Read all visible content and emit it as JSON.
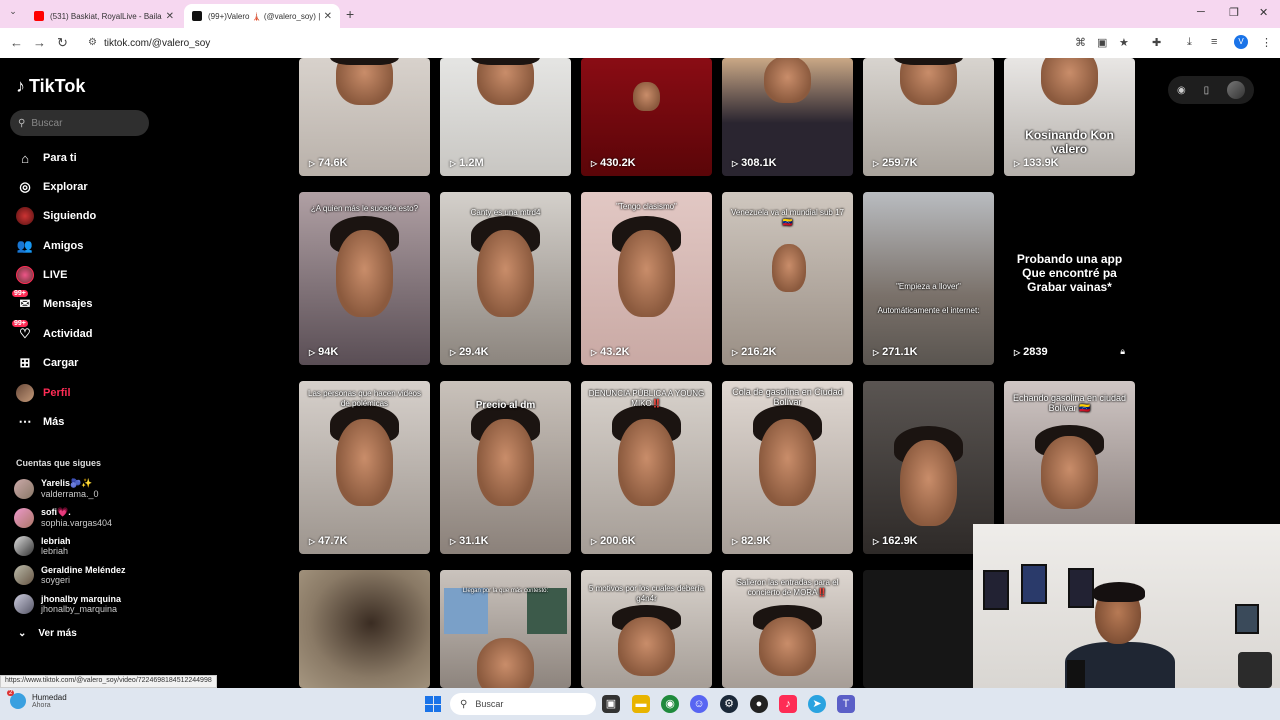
{
  "browser": {
    "tabs": [
      {
        "title": "(531) Baskiat, RoyalLive - Bailan",
        "active": false
      },
      {
        "title": "(99+)Valero 🗼 (@valero_soy) |",
        "active": true
      }
    ],
    "url": "tiktok.com/@valero_soy",
    "status_url": "https://www.tiktok.com/@valero_soy/video/7224698184512244998"
  },
  "sidebar": {
    "logo": "TikTok",
    "search_placeholder": "Buscar",
    "nav": [
      {
        "label": "Para ti",
        "icon": "home-icon"
      },
      {
        "label": "Explorar",
        "icon": "compass-icon"
      },
      {
        "label": "Siguiendo",
        "icon": "following-avatar-icon"
      },
      {
        "label": "Amigos",
        "icon": "friends-icon"
      },
      {
        "label": "LIVE",
        "icon": "live-icon"
      },
      {
        "label": "Mensajes",
        "icon": "messages-icon",
        "badge": "99+"
      },
      {
        "label": "Actividad",
        "icon": "activity-icon",
        "badge": "99+"
      },
      {
        "label": "Cargar",
        "icon": "upload-icon"
      },
      {
        "label": "Perfil",
        "icon": "profile-avatar-icon",
        "active": true
      },
      {
        "label": "Más",
        "icon": "more-icon"
      }
    ],
    "following_title": "Cuentas que sigues",
    "following": [
      {
        "name": "Yarelis🫐✨",
        "handle": "valderrama._0"
      },
      {
        "name": "sofi💗.",
        "handle": "sophia.vargas404"
      },
      {
        "name": "lebriah",
        "handle": "lebriah"
      },
      {
        "name": "Geraldine Meléndez",
        "handle": "soygeri"
      },
      {
        "name": "jhonalby marquina",
        "handle": "jhonalby_marquina"
      }
    ],
    "see_more": "Ver más"
  },
  "videos": [
    {
      "views": "74.6K",
      "caption": ""
    },
    {
      "views": "1.2M",
      "caption": ""
    },
    {
      "views": "430.2K",
      "caption": ""
    },
    {
      "views": "308.1K",
      "caption": ""
    },
    {
      "views": "259.7K",
      "caption": ""
    },
    {
      "views": "133.9K",
      "caption": "Kosinando Kon valero"
    },
    {
      "views": "94K",
      "caption": "¿A quien más le sucede esto?"
    },
    {
      "views": "29.4K",
      "caption": "Canty es una mtrd4"
    },
    {
      "views": "43.2K",
      "caption": "\"Tengo clasismo\""
    },
    {
      "views": "216.2K",
      "caption": "Venezuela va al mundial sub 17 🇻🇪"
    },
    {
      "views": "271.1K",
      "caption": "\"Empieza a llover\"",
      "caption2": "Automáticamente el internet:"
    },
    {
      "views": "2839",
      "caption": "Probando una app Que encontré pa Grabar vainas*",
      "locked": true
    },
    {
      "views": "47.7K",
      "caption": "Las personas que hacen videos de polémicas"
    },
    {
      "views": "31.1K",
      "caption": "Precio al dm"
    },
    {
      "views": "200.6K",
      "caption": "DENUNCIA PÚBLICA A YOUNG MIKO‼️"
    },
    {
      "views": "82.9K",
      "caption": "Cola de gasolina en Ciudad Bolívar"
    },
    {
      "views": "162.9K",
      "caption": ""
    },
    {
      "views": "",
      "caption": "Echando gasolina en ciudad Bolívar 🇻🇪"
    },
    {
      "views": "",
      "caption": ""
    },
    {
      "views": "",
      "caption": "Llegan por la que más contestó:"
    },
    {
      "views": "",
      "caption": "5 motivos por los cuales debería g4n4r"
    },
    {
      "views": "",
      "caption": "Salieron las entradas para el concierto de MORA‼️"
    }
  ],
  "taskbar": {
    "weather_badge": "2",
    "weather_title": "Humedad",
    "weather_sub": "Ahora",
    "search_placeholder": "Buscar"
  }
}
